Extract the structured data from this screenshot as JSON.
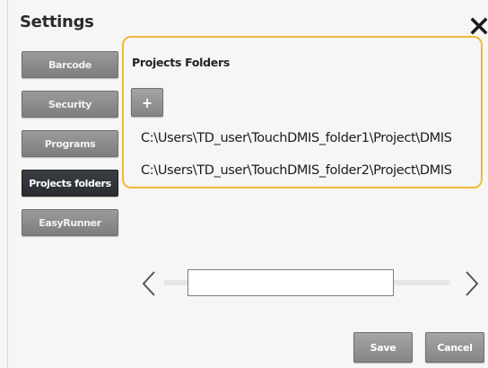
{
  "window": {
    "title": "Settings"
  },
  "icons": {
    "close": "close-icon",
    "add": "plus-icon",
    "scroll_left": "chevron-left-icon",
    "scroll_right": "chevron-right-icon"
  },
  "nav": {
    "items": [
      {
        "label": "Barcode",
        "active": false
      },
      {
        "label": "Security",
        "active": false
      },
      {
        "label": "Programs",
        "active": false
      },
      {
        "label": "Projects folders",
        "active": true
      },
      {
        "label": "EasyRunner",
        "active": false
      }
    ]
  },
  "panel": {
    "title": "Projects Folders",
    "add_label": "+",
    "folders": [
      "C:\\Users\\TD_user\\TouchDMIS_folder1\\Project\\DMIS",
      "C:\\Users\\TD_user\\TouchDMIS_folder2\\Project\\DMIS"
    ]
  },
  "footer": {
    "save_label": "Save",
    "cancel_label": "Cancel"
  },
  "colors": {
    "highlight": "#f0b93a",
    "active_nav": "#2e3135",
    "button": "#8e8e8e"
  }
}
